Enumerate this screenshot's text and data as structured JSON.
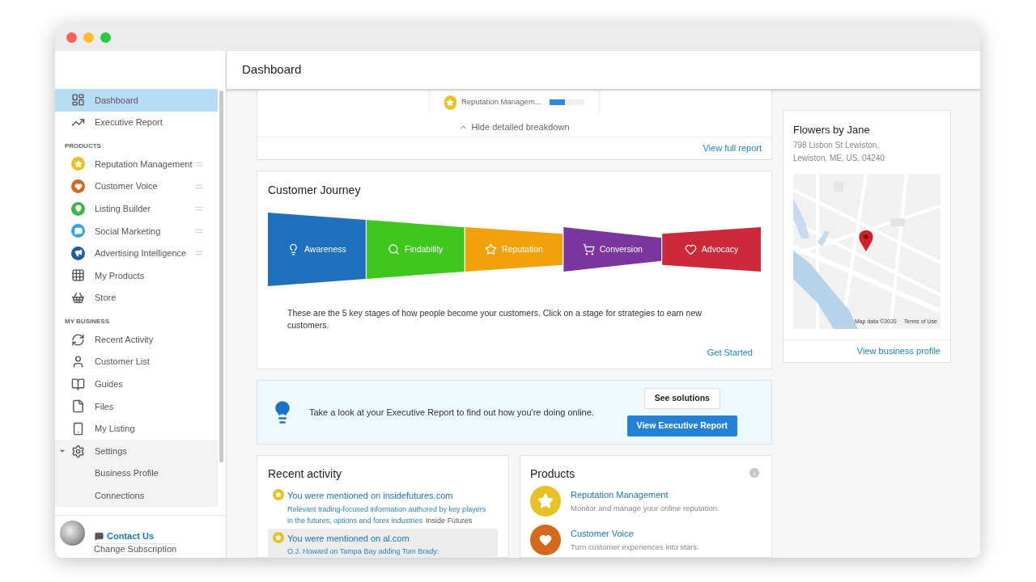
{
  "header": {
    "title": "Dashboard"
  },
  "sidebar": {
    "sections": [
      {
        "items": [
          {
            "label": "Dashboard",
            "selected": true
          },
          {
            "label": "Executive Report",
            "selected": false
          }
        ]
      },
      {
        "heading": "PRODUCTS",
        "items": [
          {
            "label": "Reputation Management",
            "selected": false,
            "color": "#e8c124"
          },
          {
            "label": "Customer Voice",
            "selected": false,
            "color": "#d4691e"
          },
          {
            "label": "Listing Builder",
            "selected": false,
            "color": "#3fb449"
          },
          {
            "label": "Social Marketing",
            "selected": false,
            "color": "#35a3dc"
          },
          {
            "label": "Advertising Intelligence",
            "selected": false,
            "color": "#1f5fa0"
          },
          {
            "label": "My Products",
            "selected": false
          },
          {
            "label": "Store",
            "selected": false
          }
        ]
      },
      {
        "heading": "MY BUSINESS",
        "items": [
          {
            "label": "Recent Activity",
            "selected": false
          },
          {
            "label": "Customer List",
            "selected": false
          },
          {
            "label": "Guides",
            "selected": false
          },
          {
            "label": "Files",
            "selected": false
          },
          {
            "label": "My Listing",
            "selected": false
          },
          {
            "label": "Settings",
            "selected": false,
            "expanded": true,
            "children": [
              {
                "label": "Business Profile",
                "selected": false
              },
              {
                "label": "Connections",
                "selected": false
              }
            ]
          }
        ]
      }
    ],
    "footer": {
      "contact": "Contact Us",
      "subscription": "Change Subscription"
    }
  },
  "breakdown": {
    "row": {
      "label": "Reputation Managem...",
      "level": 0.45
    },
    "toggle": "Hide detailed breakdown",
    "link": "View full report"
  },
  "journey": {
    "title": "Customer Journey",
    "stages": [
      {
        "label": "Awareness",
        "color": "#1f6fbf"
      },
      {
        "label": "Findability",
        "color": "#3fc61f"
      },
      {
        "label": "Reputation",
        "color": "#f1a10a"
      },
      {
        "label": "Conversion",
        "color": "#7a35a0"
      },
      {
        "label": "Advocacy",
        "color": "#cc2a3a"
      }
    ],
    "text": "These are the 5 key stages of how people become your customers. Click on a stage for strategies to earn new customers.",
    "link": "Get Started"
  },
  "banner": {
    "text": "Take a look at your Executive Report to find out how you're doing online.",
    "secondary": "See solutions",
    "primary": "View Executive Report"
  },
  "recent": {
    "title": "Recent activity",
    "items": [
      {
        "title": "You were mentioned on insidefutures.com",
        "description": "Relevant trading-focused information authored by key players in the futures, options and forex industries",
        "source": "Inside Futures",
        "highlighted": false
      },
      {
        "title": "You were mentioned on al.com",
        "description": "O.J. Howard on Tampa Bay adding Tom Brady:",
        "highlighted": true
      }
    ]
  },
  "products": {
    "title": "Products",
    "items": [
      {
        "name": "Reputation Management",
        "description": "Monitor and manage your online reputation.",
        "color": "#e8c124"
      },
      {
        "name": "Customer Voice",
        "description": "Turn customer experiences into stars.",
        "color": "#d4691e"
      }
    ]
  },
  "business": {
    "name": "Flowers by Jane",
    "address_lines": [
      "798 Lisbon St Lewiston,",
      "Lewiston, ME, US, 04240"
    ],
    "map_credit": "Map data ©2020",
    "map_terms": "Terms of Use",
    "link": "View business profile"
  }
}
